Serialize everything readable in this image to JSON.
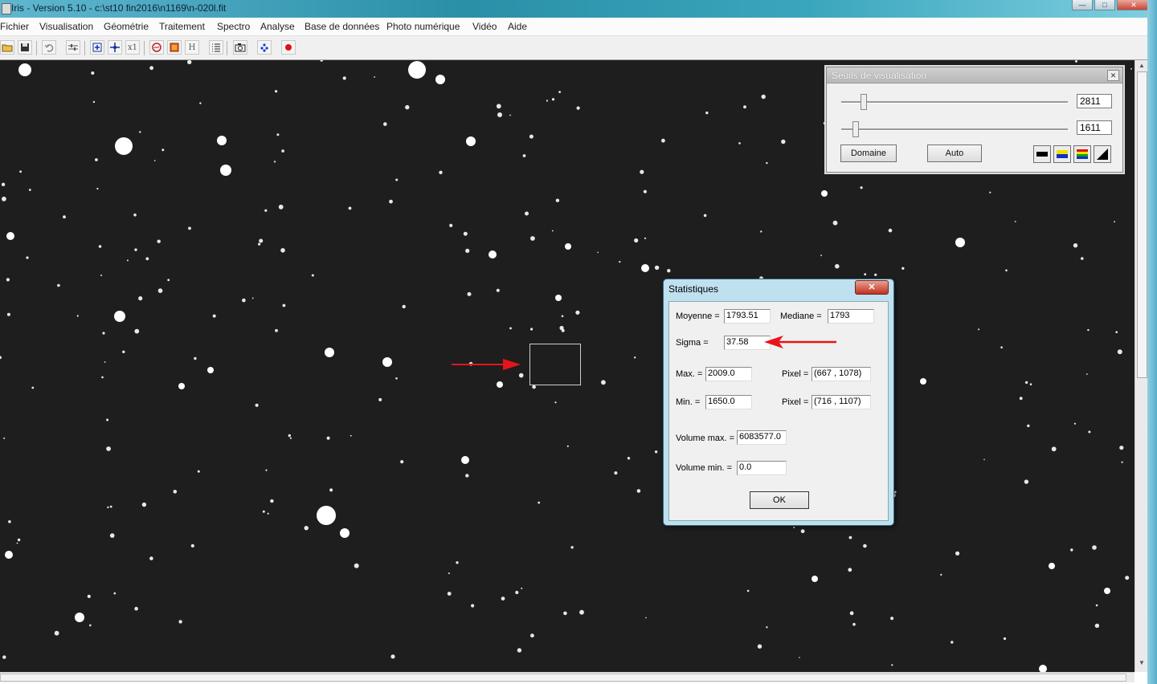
{
  "window": {
    "title": "Iris - Version 5.10 - c:\\st10 fin2016\\n1169\\n-020l.fit"
  },
  "menu": [
    "Fichier",
    "Visualisation",
    "Géométrie",
    "Traitement",
    "Spectro",
    "Analyse",
    "Base de données",
    "Photo numérique",
    "Vidéo",
    "Aide"
  ],
  "toolbar": {
    "icons": [
      "open-folder-icon",
      "save-icon",
      "undo-icon",
      "adjust-icon",
      "zoom-icon",
      "move-icon",
      "x1",
      "curve-icon",
      "palette-icon",
      "H",
      "list-icon",
      "camera-icon",
      "stars-icon",
      "record-icon"
    ],
    "x1_label": "x1",
    "h_label": "H"
  },
  "seuils": {
    "title": "Seuils de visualisation",
    "high": "2811",
    "low": "1611",
    "domaine_label": "Domaine",
    "auto_label": "Auto",
    "color_modes": [
      "black-white-icon",
      "blue-yellow-icon",
      "rainbow-icon",
      "gradient-icon"
    ]
  },
  "stats": {
    "title": "Statistiques",
    "moyenne_label": "Moyenne =",
    "moyenne": "1793.51",
    "mediane_label": "Mediane =",
    "mediane": "1793",
    "sigma_label": "Sigma =",
    "sigma": "37.58",
    "max_label": "Max. =",
    "max": "2009.0",
    "max_pixel_label": "Pixel =",
    "max_pixel": "(667 , 1078)",
    "min_label": "Min. =",
    "min": "1650.0",
    "min_pixel_label": "Pixel =",
    "min_pixel": "(716 , 1107)",
    "vol_max_label": "Volume max. =",
    "vol_max": "6083577.0",
    "vol_min_label": "Volume min. =",
    "vol_min": "0.0",
    "ok_label": "OK"
  },
  "colors": {
    "annotation_arrow": "#e8141b",
    "sky": "#1e1e1e"
  }
}
